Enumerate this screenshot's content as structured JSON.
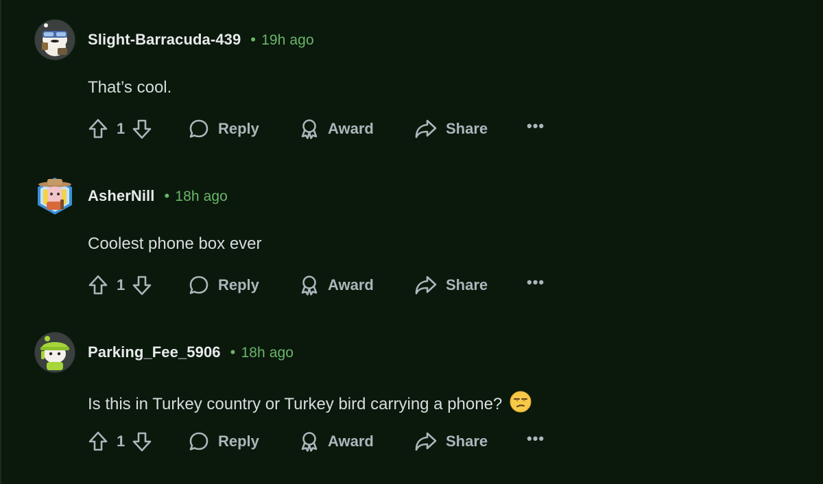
{
  "comments": [
    {
      "username": "Slight-Barracuda-439",
      "separator": "•",
      "time": "19h ago",
      "text": "That’s cool.",
      "votes": "1",
      "reply_label": "Reply",
      "award_label": "Award",
      "share_label": "Share",
      "more_label": "•••",
      "avatar": "snoo-avatar-goggles-icon"
    },
    {
      "username": "AsherNill",
      "separator": "•",
      "time": "18h ago",
      "text": "Coolest phone box ever",
      "votes": "1",
      "reply_label": "Reply",
      "award_label": "Award",
      "share_label": "Share",
      "more_label": "•••",
      "avatar": "snoo-avatar-cowboy-icon"
    },
    {
      "username": "Parking_Fee_5906",
      "separator": "•",
      "time": "18h ago",
      "text": "Is this in Turkey country or Turkey bird carrying a phone?",
      "emoji": "unamused-face-emoji",
      "votes": "1",
      "reply_label": "Reply",
      "award_label": "Award",
      "share_label": "Share",
      "more_label": "•••",
      "avatar": "snoo-avatar-green-hat-icon"
    }
  ],
  "colors": {
    "background": "#0a190c",
    "timestamp": "#6bb56a",
    "action_text": "#aeb5bb",
    "username": "#e8eaec"
  }
}
